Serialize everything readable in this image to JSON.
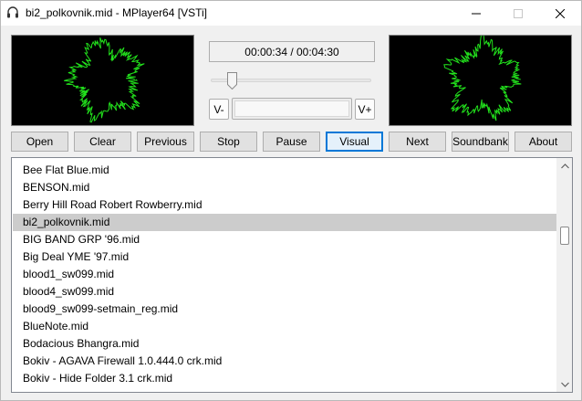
{
  "window": {
    "title": "bi2_polkovnik.mid - MPlayer64 [VSTi]",
    "app_icon": "headphones-icon",
    "controls": {
      "minimize": "—",
      "maximize": "☐",
      "close": "✕"
    }
  },
  "player": {
    "time_display": "00:00:34 / 00:04:30",
    "seek_progress": 0.126,
    "volume_down_label": "V-",
    "volume_up_label": "V+",
    "visualizer_color": "#22e11c"
  },
  "toolbar": {
    "open": "Open",
    "clear": "Clear",
    "previous": "Previous",
    "stop": "Stop",
    "pause": "Pause",
    "visual": "Visual",
    "next": "Next",
    "soundbank": "Soundbank",
    "about": "About"
  },
  "playlist": {
    "items": [
      "Bee Flat Blue.mid",
      "BENSON.mid",
      "Berry Hill Road Robert Rowberry.mid",
      "bi2_polkovnik.mid",
      "BIG BAND GRP '96.mid",
      "Big Deal YME '97.mid",
      "blood1_sw099.mid",
      "blood4_sw099.mid",
      "blood9_sw099-setmain_reg.mid",
      "BlueNote.mid",
      "Bodacious Bhangra.mid",
      "Bokiv - AGAVA Firewall 1.0.444.0 crk.mid",
      "Bokiv - Hide Folder 3.1 crk.mid"
    ],
    "selected_index": 3
  }
}
